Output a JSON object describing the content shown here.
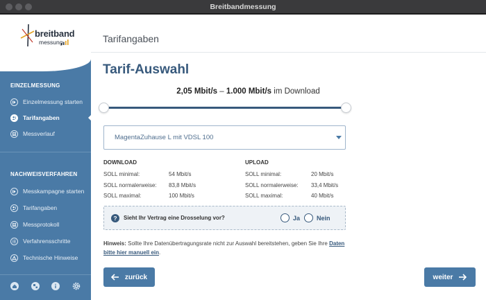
{
  "window": {
    "title": "Breitbandmessung"
  },
  "logo": {
    "word1": "breitband",
    "word2": "messung"
  },
  "sidebar": {
    "section1_title": "EINZELMESSUNG",
    "section1_items": [
      {
        "label": "Einzelmessung starten",
        "icon": "play-icon"
      },
      {
        "label": "Tarifangaben",
        "icon": "tariff-icon",
        "active": true
      },
      {
        "label": "Messverlauf",
        "icon": "history-icon"
      }
    ],
    "section2_title": "NACHWEISVERFAHREN",
    "section2_items": [
      {
        "label": "Messkampagne starten",
        "icon": "play-icon"
      },
      {
        "label": "Tarifangaben",
        "icon": "tariff-icon"
      },
      {
        "label": "Messprotokoll",
        "icon": "protocol-icon"
      },
      {
        "label": "Verfahrensschritte",
        "icon": "steps-icon"
      },
      {
        "label": "Technische Hinweise",
        "icon": "info-icon"
      }
    ],
    "bottom_icons": [
      "home-icon",
      "network-icon",
      "info-icon",
      "settings-icon"
    ]
  },
  "main": {
    "header": "Tarifangaben",
    "section_title": "Tarif-Auswahl",
    "range": {
      "min_label": "2,05 Mbit/s",
      "separator": " – ",
      "max_label": "1.000 Mbit/s",
      "suffix": " im Download",
      "min_fraction": 0.0,
      "max_fraction": 1.0
    },
    "tariff_select": {
      "value": "MagentaZuhause L mit VDSL 100"
    },
    "download": {
      "title": "DOWNLOAD",
      "rows": [
        {
          "label": "SOLL minimal:",
          "value": "54 Mbit/s"
        },
        {
          "label": "SOLL normalerweise:",
          "value": "83,8 Mbit/s"
        },
        {
          "label": "SOLL maximal:",
          "value": "100 Mbit/s"
        }
      ]
    },
    "upload": {
      "title": "UPLOAD",
      "rows": [
        {
          "label": "SOLL minimal:",
          "value": "20 Mbit/s"
        },
        {
          "label": "SOLL normalerweise:",
          "value": "33,4 Mbit/s"
        },
        {
          "label": "SOLL maximal:",
          "value": "40 Mbit/s"
        }
      ]
    },
    "question": {
      "icon": "question-icon",
      "text": "Sieht Ihr Vertrag eine Drosselung vor?",
      "options": [
        "Ja",
        "Nein"
      ]
    },
    "hint": {
      "bold": "Hinweis:",
      "text": " Sollte Ihre Datenübertragungsrate nicht zur Auswahl bereitstehen, geben Sie Ihre ",
      "link": "Daten bitte hier manuell ein",
      "end": "."
    },
    "buttons": {
      "back": "zurück",
      "next": "weiter"
    }
  },
  "colors": {
    "sidebar": "#4a7aa6",
    "accent": "#37597c",
    "button": "#4a7aa6"
  }
}
